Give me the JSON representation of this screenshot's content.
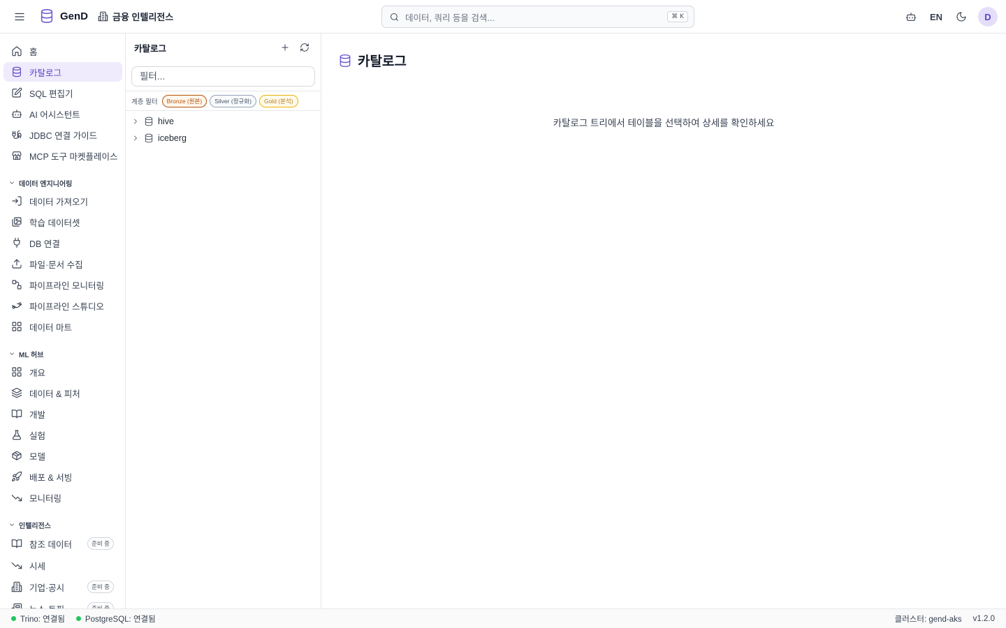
{
  "header": {
    "brand": "GenD",
    "org": "금융 인텔리전스",
    "search_placeholder": "데이터, 쿼리 등을 검색...",
    "search_shortcut": "⌘ K",
    "lang": "EN",
    "avatar": "D"
  },
  "sidebar": {
    "top_items": [
      {
        "label": "홈",
        "icon": "home-icon"
      },
      {
        "label": "카탈로그",
        "icon": "database-icon",
        "active": true
      },
      {
        "label": "SQL 편집기",
        "icon": "edit-icon"
      },
      {
        "label": "AI 어시스턴트",
        "icon": "bot-icon"
      },
      {
        "label": "JDBC 연결 가이드",
        "icon": "cable-icon"
      },
      {
        "label": "MCP 도구 마켓플레이스",
        "icon": "store-icon"
      }
    ],
    "sections": [
      {
        "title": "데이터 엔지니어링",
        "items": [
          {
            "label": "데이터 가져오기",
            "icon": "import-icon"
          },
          {
            "label": "학습 데이터셋",
            "icon": "images-icon"
          },
          {
            "label": "DB 연결",
            "icon": "plug-icon"
          },
          {
            "label": "파일·문서 수집",
            "icon": "upload-icon"
          },
          {
            "label": "파이프라인 모니터링",
            "icon": "route-icon"
          },
          {
            "label": "파이프라인 스튜디오",
            "icon": "workflow-icon"
          },
          {
            "label": "데이터 마트",
            "icon": "grid-icon"
          }
        ]
      },
      {
        "title": "ML 허브",
        "items": [
          {
            "label": "개요",
            "icon": "grid-icon"
          },
          {
            "label": "데이터 & 피처",
            "icon": "layers-icon"
          },
          {
            "label": "개발",
            "icon": "book-icon"
          },
          {
            "label": "실험",
            "icon": "flask-icon"
          },
          {
            "label": "모델",
            "icon": "package-icon"
          },
          {
            "label": "배포 & 서빙",
            "icon": "rocket-icon"
          },
          {
            "label": "모니터링",
            "icon": "trend-down-icon"
          }
        ]
      },
      {
        "title": "인텔리전스",
        "items": [
          {
            "label": "참조 데이터",
            "icon": "book-icon",
            "badge": "준비 중"
          },
          {
            "label": "시세",
            "icon": "trend-down-icon"
          },
          {
            "label": "기업·공시",
            "icon": "building-icon",
            "badge": "준비 중"
          },
          {
            "label": "뉴스·토픽",
            "icon": "newspaper-icon",
            "badge": "준비 중"
          }
        ]
      }
    ]
  },
  "catalog_panel": {
    "title": "카탈로그",
    "filter_placeholder": "필터...",
    "tier_label": "계층 필터",
    "tiers": [
      {
        "label": "Bronze (원본)",
        "color": "#b45309",
        "bg": "#fff7ed",
        "border": "#b45309"
      },
      {
        "label": "Silver (정규화)",
        "color": "#475569",
        "bg": "#f8fafc",
        "border": "#94a3b8"
      },
      {
        "label": "Gold (분석)",
        "color": "#b7791f",
        "bg": "#fffbeb",
        "border": "#eab308"
      }
    ],
    "tree": [
      "hive",
      "iceberg"
    ]
  },
  "main": {
    "title": "카탈로그",
    "empty_message": "카탈로그 트리에서 테이블을 선택하여 상세를 확인하세요"
  },
  "statusbar": {
    "trino": "Trino: 연결됨",
    "postgres": "PostgreSQL: 연결됨",
    "cluster": "클러스터: gend-aks",
    "version": "v1.2.0",
    "status_color": "#22c55e"
  },
  "colors": {
    "accent": "#6d5bd0",
    "active_bg": "#efebfc"
  }
}
